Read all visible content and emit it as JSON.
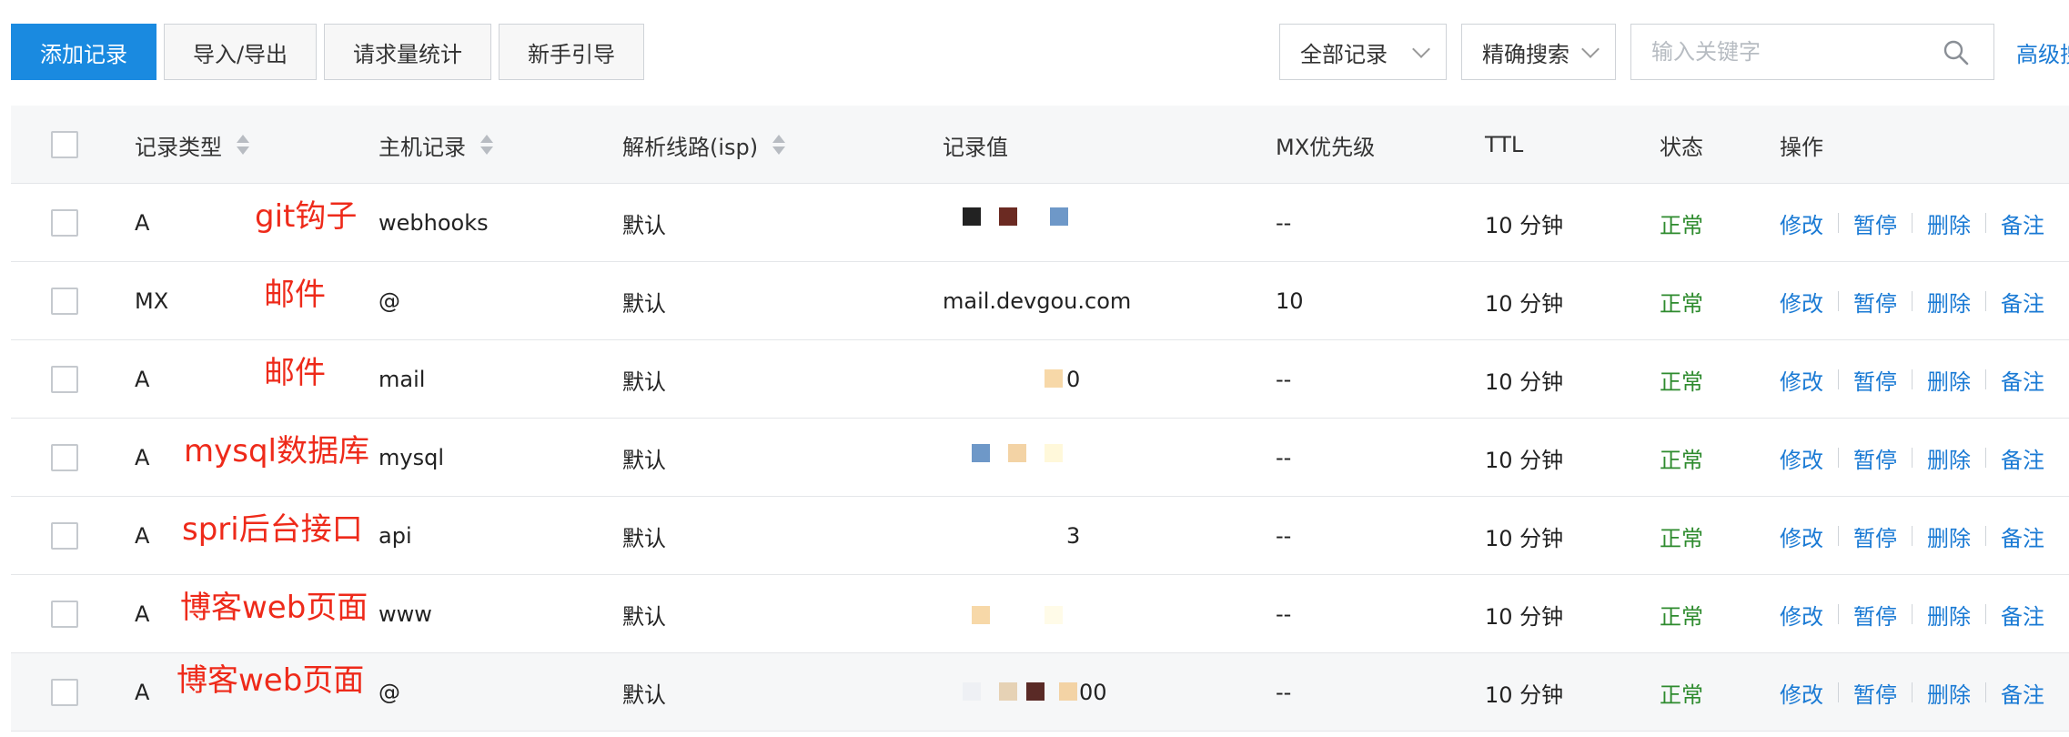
{
  "toolbar": {
    "add_label": "添加记录",
    "import_export_label": "导入/导出",
    "stats_label": "请求量统计",
    "guide_label": "新手引导",
    "filter_label": "全部记录",
    "search_mode_label": "精确搜索",
    "search_placeholder": "输入关键字",
    "advanced_label": "高级搜索"
  },
  "table": {
    "headers": {
      "type": "记录类型",
      "host": "主机记录",
      "line": "解析线路(isp)",
      "value": "记录值",
      "mx": "MX优先级",
      "ttl": "TTL",
      "status": "状态",
      "ops": "操作"
    },
    "op_labels": [
      "修改",
      "暂停",
      "删除",
      "备注"
    ],
    "rows": [
      {
        "type": "A",
        "note": "git钩子",
        "host": "webhooks",
        "line": "默认",
        "value": "",
        "mx": "--",
        "ttl": "10 分钟",
        "status": "正常"
      },
      {
        "type": "MX",
        "note": "邮件",
        "host": "@",
        "line": "默认",
        "value": "mail.devgou.com",
        "mx": "10",
        "ttl": "10 分钟",
        "status": "正常"
      },
      {
        "type": "A",
        "note": "邮件",
        "host": "mail",
        "line": "默认",
        "value": "0",
        "mx": "--",
        "ttl": "10 分钟",
        "status": "正常"
      },
      {
        "type": "A",
        "note": "mysql数据库",
        "host": "mysql",
        "line": "默认",
        "value": "",
        "mx": "--",
        "ttl": "10 分钟",
        "status": "正常"
      },
      {
        "type": "A",
        "note": "spri后台接口",
        "host": "api",
        "line": "默认",
        "value": "3",
        "mx": "--",
        "ttl": "10 分钟",
        "status": "正常"
      },
      {
        "type": "A",
        "note": "博客web页面",
        "host": "www",
        "line": "默认",
        "value": "",
        "mx": "--",
        "ttl": "10 分钟",
        "status": "正常"
      },
      {
        "type": "A",
        "note": "博客web页面",
        "host": "@",
        "line": "默认",
        "value": "00",
        "mx": "--",
        "ttl": "10 分钟",
        "status": "正常"
      }
    ]
  },
  "colors": {
    "primary": "#1a8ae0",
    "link": "#1a7ad4",
    "status_ok": "#2e8b2e",
    "annotation": "#ee2a1a"
  }
}
